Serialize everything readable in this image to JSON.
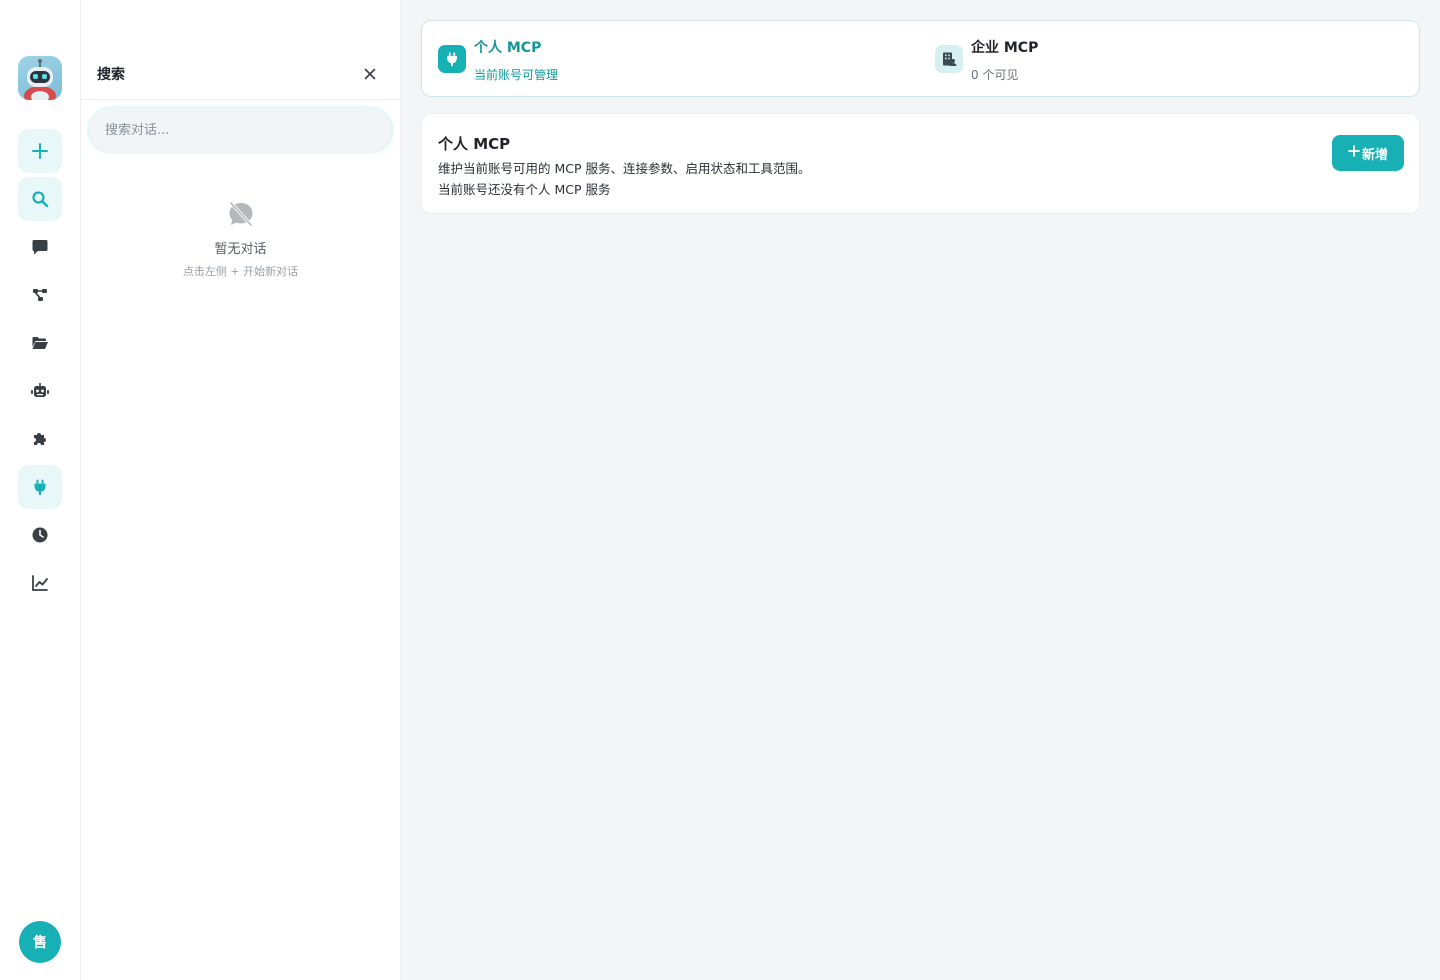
{
  "brand": {
    "accent": "#17b1b5",
    "accent_dark": "#14979b"
  },
  "rail": {
    "logo_icon": "robot-mascot-icon",
    "items": [
      {
        "name": "new-chat",
        "icon": "plus-icon"
      },
      {
        "name": "search",
        "icon": "search-icon"
      },
      {
        "name": "chats",
        "icon": "chat-bubble-icon"
      },
      {
        "name": "workflow",
        "icon": "workflow-icon"
      },
      {
        "name": "files",
        "icon": "folder-open-icon"
      },
      {
        "name": "agents",
        "icon": "robot-icon"
      },
      {
        "name": "plugins",
        "icon": "puzzle-icon"
      },
      {
        "name": "mcp",
        "icon": "plug-icon"
      },
      {
        "name": "history",
        "icon": "clock-icon"
      },
      {
        "name": "analytics",
        "icon": "line-chart-icon"
      }
    ],
    "avatar_label": "售"
  },
  "search_panel": {
    "title": "搜索",
    "placeholder": "搜索对话...",
    "empty_title": "暂无对话",
    "empty_subtitle": "点击左侧 + 开始新对话"
  },
  "tabs": [
    {
      "title": "个人 MCP",
      "subtitle": "当前账号可管理",
      "icon": "plug-icon"
    },
    {
      "title": "企业 MCP",
      "subtitle": "0 个可见",
      "icon": "building-icon"
    }
  ],
  "section": {
    "title": "个人 MCP",
    "description": "维护当前账号可用的 MCP 服务、连接参数、启用状态和工具范围。",
    "empty_text": "当前账号还没有个人 MCP 服务",
    "add_label": "新增"
  }
}
